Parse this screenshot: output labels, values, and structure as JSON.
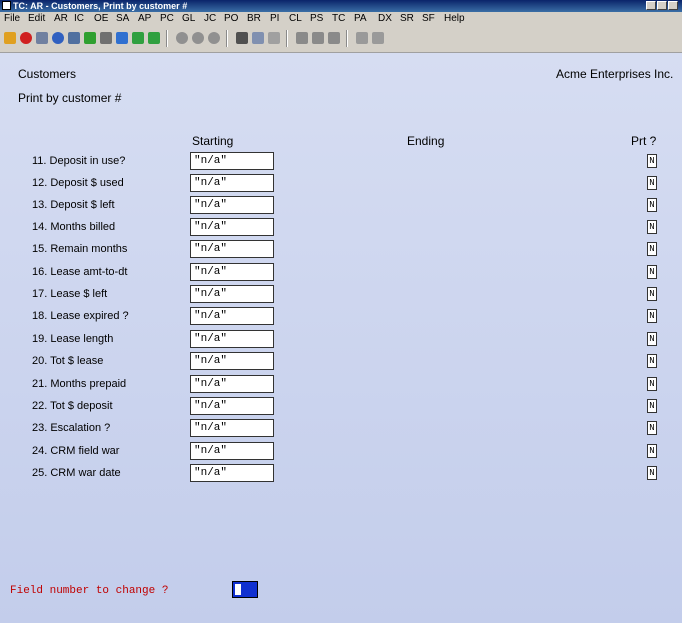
{
  "window": {
    "title": "TC: AR - Customers, Print by customer #"
  },
  "menu": [
    "File",
    "Edit",
    "AR",
    "IC",
    "OE",
    "SA",
    "AP",
    "PC",
    "GL",
    "JC",
    "PO",
    "BR",
    "PI",
    "CL",
    "PS",
    "TC",
    "PA",
    "DX",
    "SR",
    "SF",
    "Help"
  ],
  "toolbar": {
    "icons": [
      "exit-icon",
      "cancel-icon",
      "search-icon",
      "globe-icon",
      "grid-icon",
      "check-icon",
      "delete-icon",
      "undo-icon",
      "up-icon",
      "down-icon",
      "circle1-icon",
      "circle2-icon",
      "circle3-icon",
      "binoculars-icon",
      "find-icon",
      "clear-icon",
      "prev-icon",
      "next-icon",
      "stop-icon",
      "print-icon",
      "preview-icon"
    ]
  },
  "header": {
    "screen": "Customers",
    "company": "Acme Enterprises Inc.",
    "subtitle": "Print by customer #"
  },
  "columns": {
    "starting": "Starting",
    "ending": "Ending",
    "prt": "Prt ?"
  },
  "rows": [
    {
      "label": "11. Deposit in use?",
      "starting": "\"n/a\"",
      "prt": "N"
    },
    {
      "label": "12. Deposit $ used",
      "starting": "\"n/a\"",
      "prt": "N"
    },
    {
      "label": "13. Deposit $ left",
      "starting": "\"n/a\"",
      "prt": "N"
    },
    {
      "label": "14. Months billed",
      "starting": "\"n/a\"",
      "prt": "N"
    },
    {
      "label": "15. Remain months",
      "starting": "\"n/a\"",
      "prt": "N"
    },
    {
      "label": "16. Lease amt-to-dt",
      "starting": "\"n/a\"",
      "prt": "N"
    },
    {
      "label": "17. Lease $ left",
      "starting": "\"n/a\"",
      "prt": "N"
    },
    {
      "label": "18. Lease expired ?",
      "starting": "\"n/a\"",
      "prt": "N"
    },
    {
      "label": "19. Lease length",
      "starting": "\"n/a\"",
      "prt": "N"
    },
    {
      "label": "20. Tot $ lease",
      "starting": "\"n/a\"",
      "prt": "N"
    },
    {
      "label": "21. Months prepaid",
      "starting": "\"n/a\"",
      "prt": "N"
    },
    {
      "label": "22. Tot $ deposit",
      "starting": "\"n/a\"",
      "prt": "N"
    },
    {
      "label": "23. Escalation ?",
      "starting": "\"n/a\"",
      "prt": "N"
    },
    {
      "label": "24. CRM field war",
      "starting": "\"n/a\"",
      "prt": "N"
    },
    {
      "label": "25. CRM war date",
      "starting": "\"n/a\"",
      "prt": "N"
    }
  ],
  "prompt": {
    "text": "Field number to change ?"
  }
}
